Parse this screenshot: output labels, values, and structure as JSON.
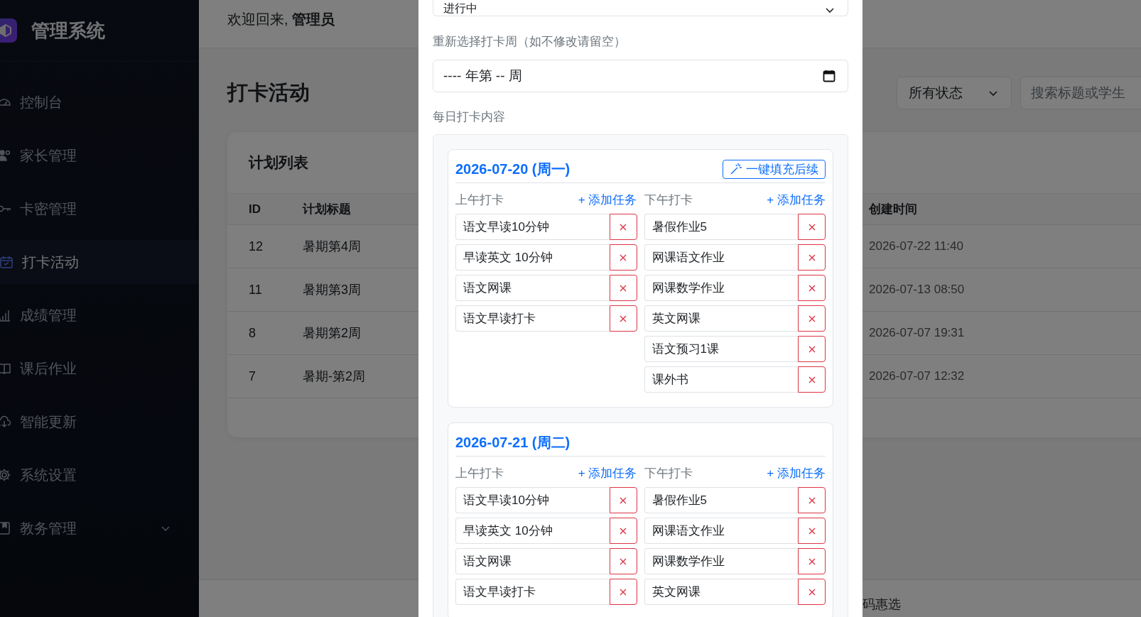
{
  "sidebar": {
    "brand": "管理系统",
    "items": [
      {
        "label": "控制台",
        "selected": false,
        "has_submenu": false
      },
      {
        "label": "家长管理",
        "selected": false,
        "has_submenu": false
      },
      {
        "label": "卡密管理",
        "selected": false,
        "has_submenu": false
      },
      {
        "label": "打卡活动",
        "selected": true,
        "has_submenu": false
      },
      {
        "label": "成绩管理",
        "selected": false,
        "has_submenu": false
      },
      {
        "label": "课后作业",
        "selected": false,
        "has_submenu": false
      },
      {
        "label": "智能更新",
        "selected": false,
        "has_submenu": false
      },
      {
        "label": "系统设置",
        "selected": false,
        "has_submenu": false
      },
      {
        "label": "教务管理",
        "selected": false,
        "has_submenu": true
      }
    ]
  },
  "header": {
    "greeting": "欢迎回来, **管理员**"
  },
  "page": {
    "title": "打卡活动",
    "status_filter": "所有状态",
    "search": {
      "placeholder": "搜索标题或学生"
    },
    "table": {
      "title": "计划列表",
      "columns": [
        "ID",
        "计划标题",
        "创建时间"
      ],
      "rows": [
        {
          "id": "12",
          "title": "暑期第4周",
          "created": "2026-07-22 11:40"
        },
        {
          "id": "11",
          "title": "暑期第3周",
          "created": "2026-07-13 08:50"
        },
        {
          "id": "8",
          "title": "暑期第2周",
          "created": "2026-07-07 19:31"
        },
        {
          "id": "7",
          "title": "暑期-第2周",
          "created": "2026-07-07 12:32"
        }
      ]
    },
    "footer": "码惠选"
  },
  "modal": {
    "status_select": "进行中",
    "week_label": "重新选择打卡周（如不修改请留空）",
    "week_value": "---- 年第 -- 周",
    "content_label": "每日打卡内容",
    "days": [
      {
        "date": "2026-07-20 (周一)",
        "fill_button": "一键填充后续",
        "am": {
          "label": "上午打卡",
          "add": "+ 添加任务",
          "tasks": [
            "语文早读10分钟",
            "早读英文 10分钟",
            "语文网课",
            "语文早读打卡"
          ]
        },
        "pm": {
          "label": "下午打卡",
          "add": "+ 添加任务",
          "tasks": [
            "暑假作业5",
            "网课语文作业",
            "网课数学作业",
            "英文网课",
            "语文预习1课",
            "课外书"
          ]
        }
      },
      {
        "date": "2026-07-21 (周二)",
        "am": {
          "label": "上午打卡",
          "add": "+ 添加任务",
          "tasks": [
            "语文早读10分钟",
            "早读英文 10分钟",
            "语文网课",
            "语文早读打卡"
          ]
        },
        "pm": {
          "label": "下午打卡",
          "add": "+ 添加任务",
          "tasks": [
            "暑假作业5",
            "网课语文作业",
            "网课数学作业",
            "英文网课"
          ]
        }
      }
    ]
  }
}
